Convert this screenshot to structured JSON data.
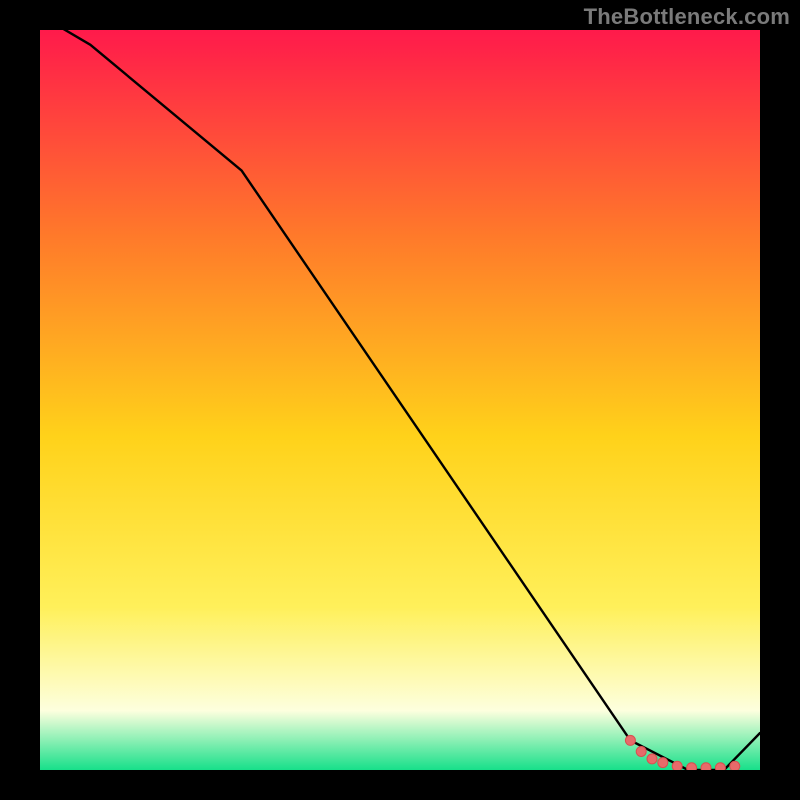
{
  "attribution": "TheBottleneck.com",
  "colors": {
    "frame": "#000000",
    "attribution_text": "#7a7a7a",
    "gradient_top": "#ff1a4b",
    "gradient_upper_mid": "#ff7a2a",
    "gradient_mid": "#ffd21a",
    "gradient_lower_mid": "#fff05a",
    "gradient_pale": "#fdffde",
    "gradient_bottom": "#17e08a",
    "line": "#000000",
    "marker_fill": "#e86a6a",
    "marker_stroke": "#d94f4f"
  },
  "chart_data": {
    "type": "line",
    "title": "",
    "xlabel": "",
    "ylabel": "",
    "xlim": [
      0,
      100
    ],
    "ylim": [
      0,
      100
    ],
    "grid": false,
    "legend": false,
    "series": [
      {
        "name": "curve",
        "x": [
          0,
          7,
          28,
          82,
          90,
          95,
          100
        ],
        "y": [
          102,
          98,
          81,
          4,
          0,
          0,
          5
        ]
      }
    ],
    "markers": {
      "name": "flat-segment-points",
      "points": [
        {
          "x": 82,
          "y": 4
        },
        {
          "x": 83.5,
          "y": 2.5
        },
        {
          "x": 85,
          "y": 1.5
        },
        {
          "x": 86.5,
          "y": 1.0
        },
        {
          "x": 88.5,
          "y": 0.5
        },
        {
          "x": 90.5,
          "y": 0.3
        },
        {
          "x": 92.5,
          "y": 0.3
        },
        {
          "x": 94.5,
          "y": 0.3
        },
        {
          "x": 96.5,
          "y": 0.5
        }
      ]
    },
    "comment": "Axis labels and ticks are not visible in the image; x/y are in percent of plot area. y=100 is top, y=0 is bottom."
  }
}
